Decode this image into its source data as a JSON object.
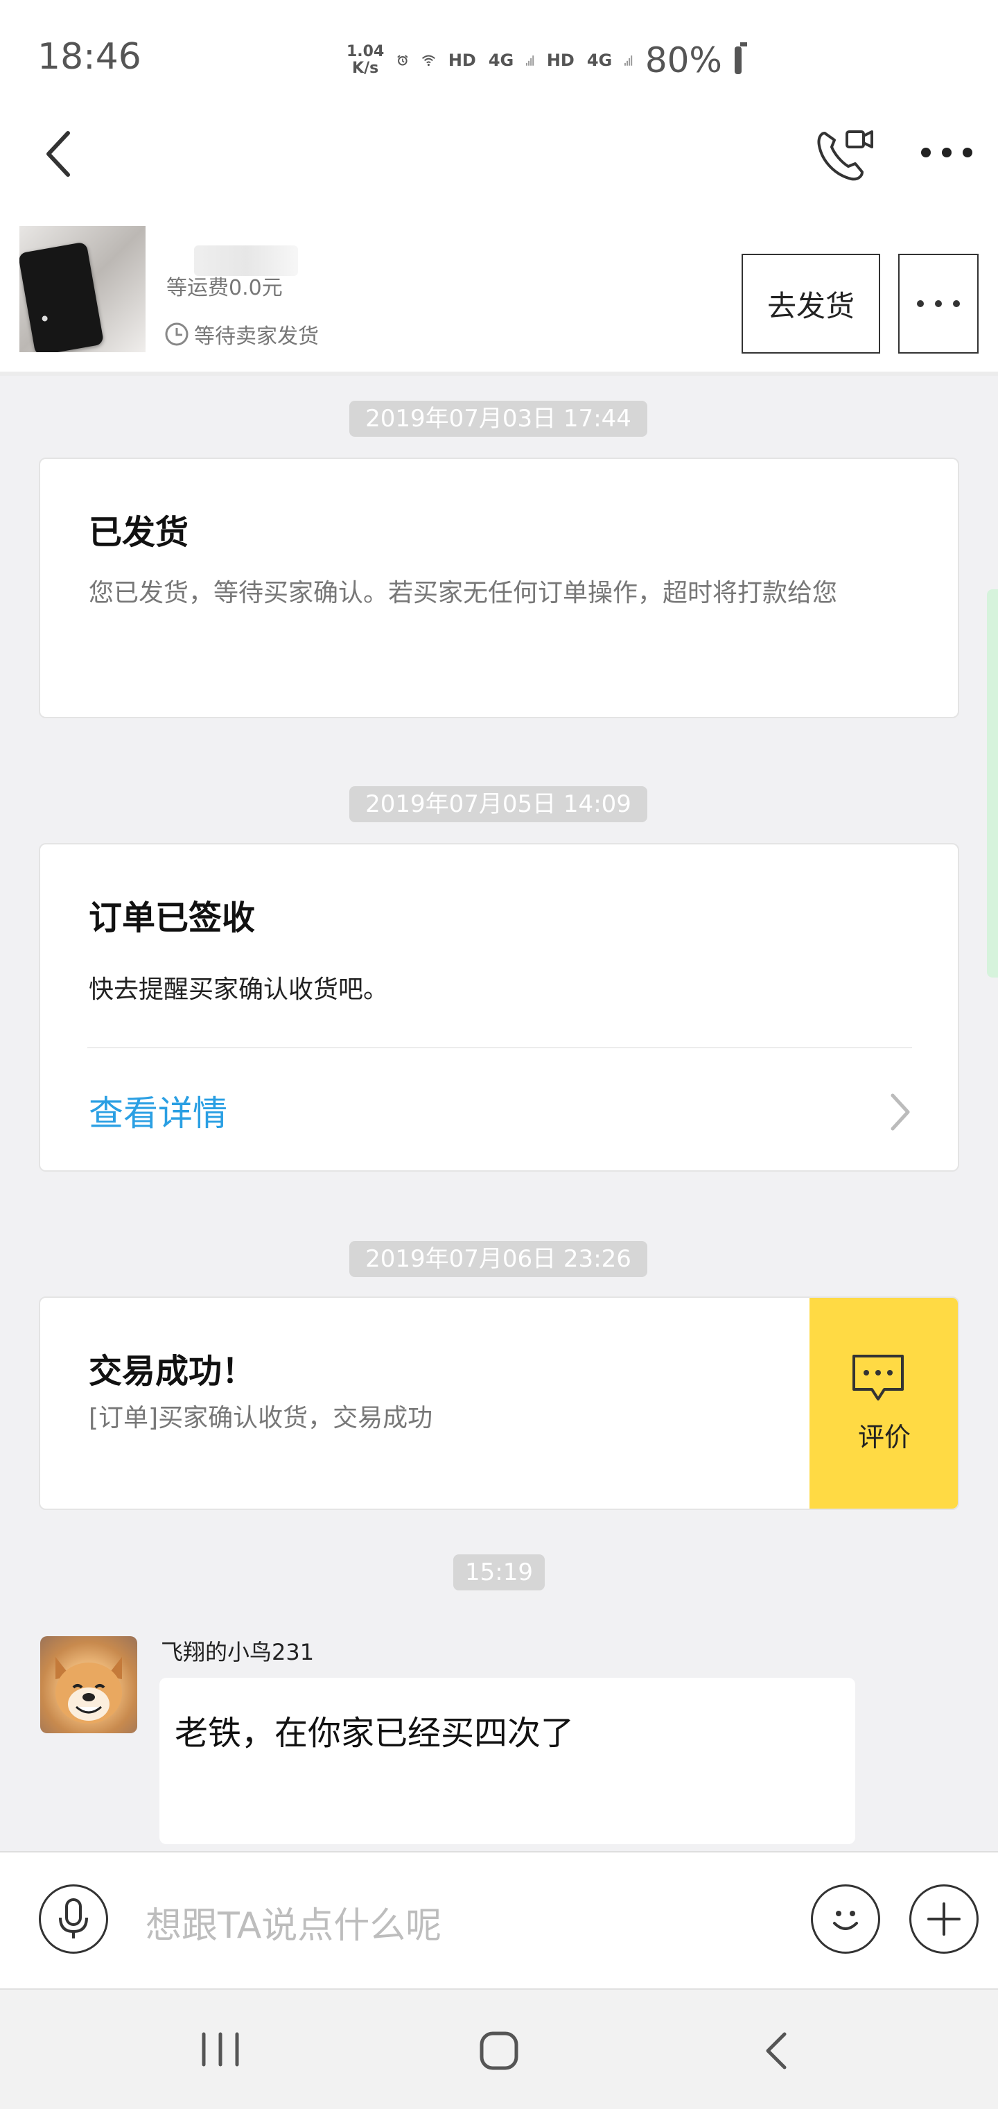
{
  "status_bar": {
    "time": "18:46",
    "net_speed_value": "1.04",
    "net_speed_unit": "K/s",
    "sim1_label": "HD",
    "sim1_net": "4G",
    "sim2_label": "HD",
    "sim2_net": "4G",
    "battery": "80%",
    "icons": [
      "alarm-icon",
      "wifi-icon",
      "signal-icon",
      "battery-icon"
    ]
  },
  "nav": {
    "icons": [
      "back-icon",
      "video-call-icon",
      "more-icon"
    ]
  },
  "product": {
    "shipping_fee": "等运费0.0元",
    "order_status": "等待卖家发货",
    "ship_button_label": "去发货"
  },
  "messages": {
    "ts1": "2019年07月03日 17:44",
    "card1_title": "已发货",
    "card1_body": "您已发货，等待买家确认。若买家无任何订单操作，超时将打款给您",
    "ts2": "2019年07月05日 14:09",
    "card2_title": "订单已签收",
    "card2_body": "快去提醒买家确认收货吧。",
    "card2_link": "查看详情",
    "ts3": "2019年07月06日 23:26",
    "card3_title": "交易成功！",
    "card3_body": "[订单]买家确认收货，交易成功",
    "card3_action": "评价",
    "ts4": "15:19",
    "sender_name": "飞翔的小鸟231",
    "message_text": "老铁，在你家已经买四次了"
  },
  "input": {
    "placeholder": "想跟TA说点什么呢"
  },
  "colors": {
    "link": "#2a9fe3",
    "accent_yellow": "#ffda44",
    "timestamp_bg": "#d6d6d6",
    "page_bg": "#f1f1f3"
  }
}
